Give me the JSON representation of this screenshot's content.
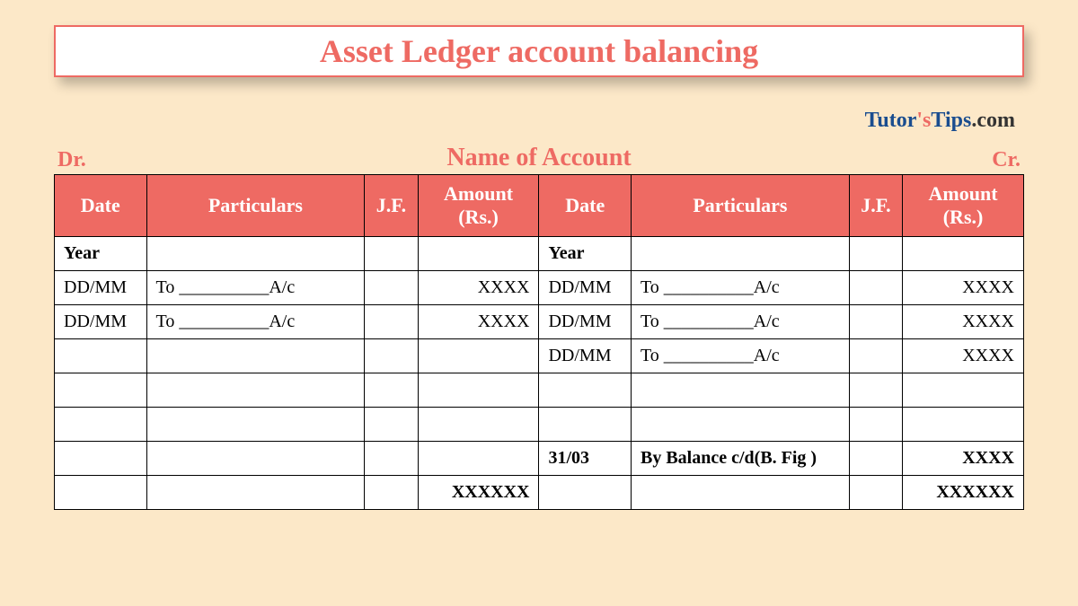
{
  "title": "Asset Ledger account balancing",
  "brand": {
    "tutor": "Tutor",
    "apostrophe": "'s",
    "tips": "Tips",
    "dotcom": ".com"
  },
  "header": {
    "dr": "Dr.",
    "account_name": "Name of Account",
    "cr": "Cr."
  },
  "columns": {
    "date": "Date",
    "particulars": "Particulars",
    "jf": "J.F.",
    "amount": "Amount (Rs.)"
  },
  "debit": {
    "year_label": "Year",
    "rows": [
      {
        "date": "DD/MM",
        "particulars": "To __________A/c",
        "jf": "",
        "amount": "XXXX"
      },
      {
        "date": "DD/MM",
        "particulars": "To __________A/c",
        "jf": "",
        "amount": "XXXX"
      },
      {
        "date": "",
        "particulars": "",
        "jf": "",
        "amount": ""
      },
      {
        "date": "",
        "particulars": "",
        "jf": "",
        "amount": ""
      },
      {
        "date": "",
        "particulars": "",
        "jf": "",
        "amount": ""
      },
      {
        "date": "",
        "particulars": "",
        "jf": "",
        "amount": ""
      }
    ],
    "total": "XXXXXX"
  },
  "credit": {
    "year_label": "Year",
    "rows": [
      {
        "date": "DD/MM",
        "particulars": "To __________A/c",
        "jf": "",
        "amount": "XXXX"
      },
      {
        "date": "DD/MM",
        "particulars": "To __________A/c",
        "jf": "",
        "amount": "XXXX"
      },
      {
        "date": "DD/MM",
        "particulars": "To __________A/c",
        "jf": "",
        "amount": "XXXX"
      },
      {
        "date": "",
        "particulars": "",
        "jf": "",
        "amount": ""
      },
      {
        "date": "",
        "particulars": "",
        "jf": "",
        "amount": ""
      },
      {
        "date": "31/03",
        "particulars": "By Balance c/d(B. Fig )",
        "jf": "",
        "amount": "XXXX",
        "bold": true
      }
    ],
    "total": "XXXXXX"
  }
}
